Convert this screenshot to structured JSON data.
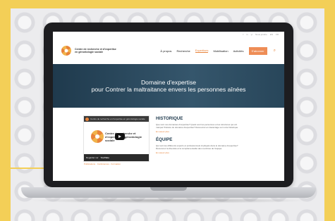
{
  "site": {
    "topbar": [
      "f",
      "in",
      "yt",
      "Nous joindre",
      "EN",
      "FR"
    ],
    "logo": {
      "line1": "Centre de recherche et d'expertise",
      "line2": "en gérontologie sociale"
    },
    "nav": [
      "À propos",
      "Recherche",
      "Expertises",
      "Mobilisation",
      "Activités"
    ],
    "nav_active_index": 2,
    "cta": "S'abonner",
    "hero": {
      "line1": "Domaine d'expertise",
      "line2": "pour Contrer la maltraitance envers les personnes aînées"
    },
    "video": {
      "bar_text": "Centre de recherche et d'expertise en gérontologie sociale",
      "title": "Centre de recherche et d'expertise en gérontologie sociale",
      "watch": "Regarder sur",
      "platform": "YouTube",
      "caption": "Publications · Conférences · Formation"
    },
    "sections": [
      {
        "title": "HISTORIQUE",
        "text": "Que sont nos domaines d'expertise? Quels sont les personnes et les structures qui ont marqué l'histoire du domaine d'expertise? Découvrez-en davantage sur notre historique.",
        "more": "En savoir plus"
      },
      {
        "title": "ÉQUIPE",
        "text": "Qui sont les différents experts et professionnels impliqués dans le domaine d'expertise? Découvrez la diversité et la complémentarité des membres de l'équipe.",
        "more": "En savoir plus"
      }
    ]
  },
  "colors": {
    "photo_background": "#f3cf57",
    "accent": "#e8833a",
    "hero": "#1f3a4d"
  }
}
